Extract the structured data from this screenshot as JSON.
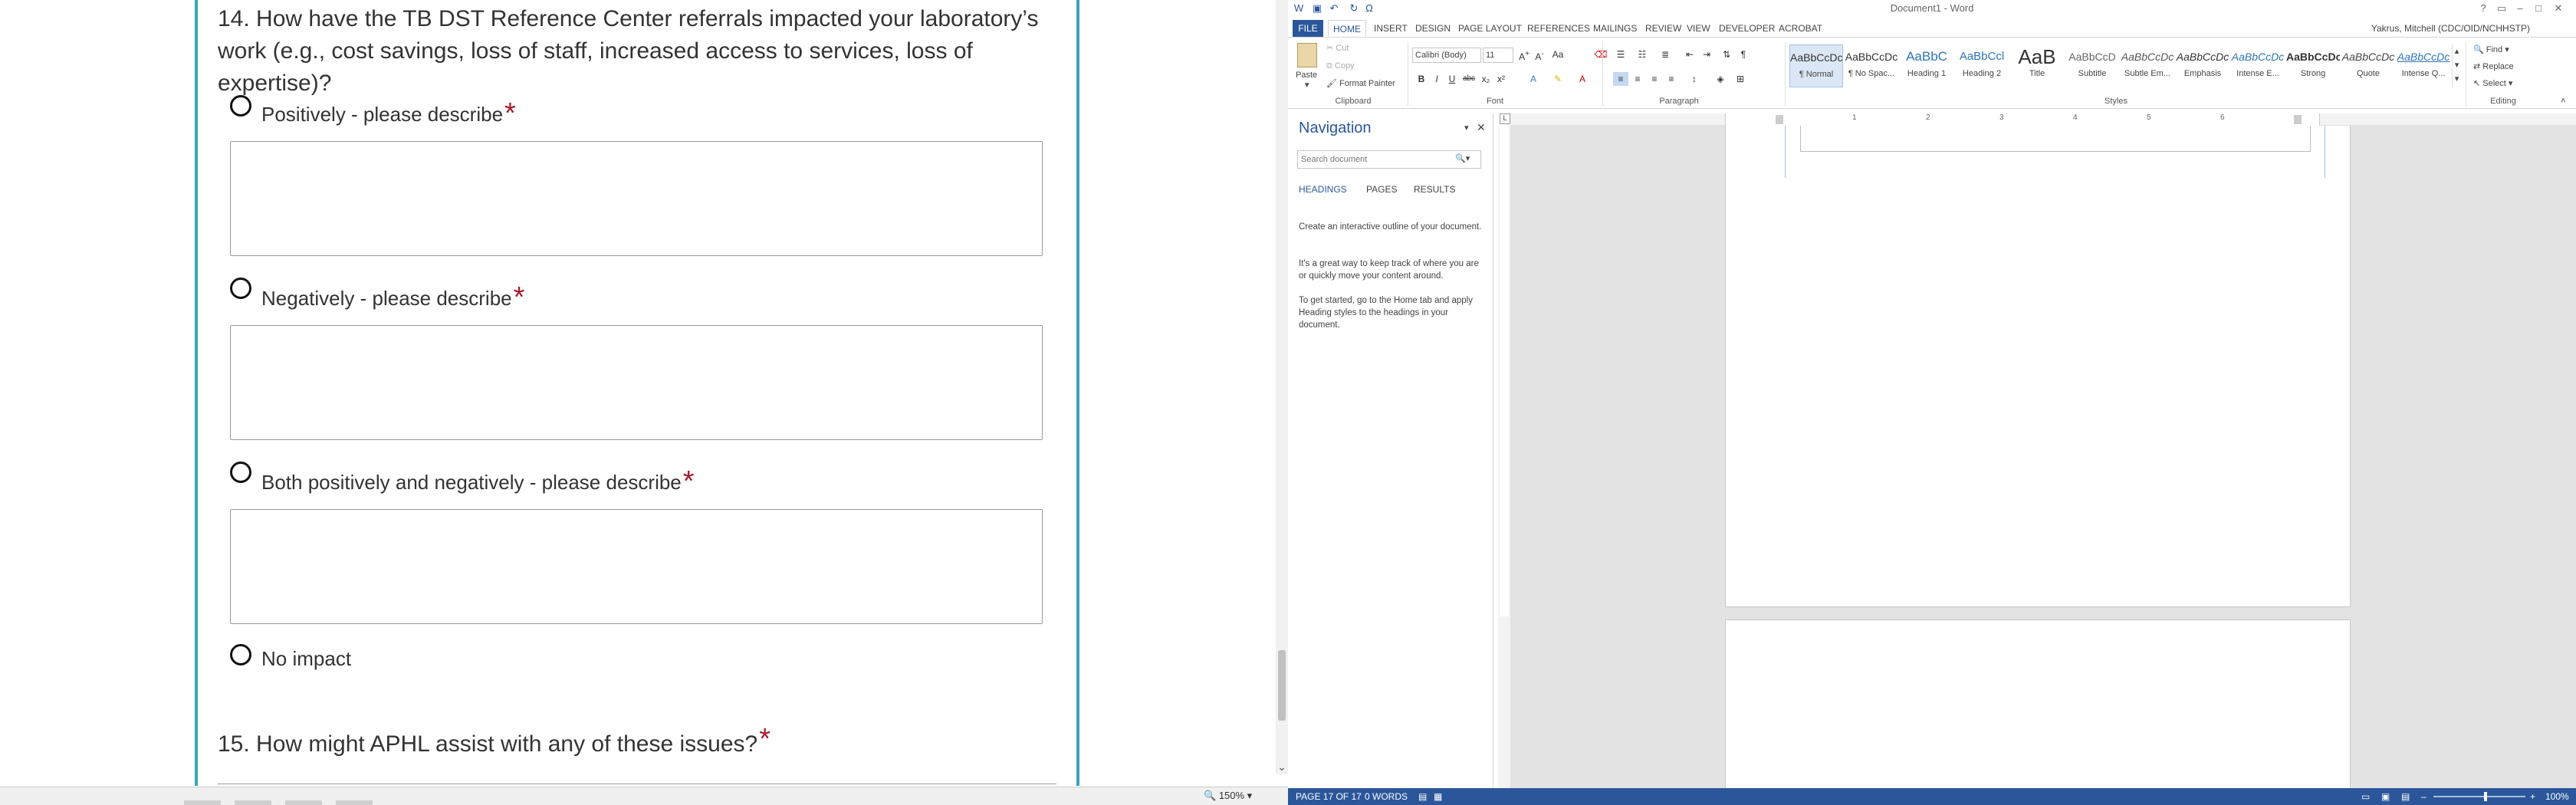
{
  "survey": {
    "q14": {
      "title": "14. How have the TB DST Reference Center referrals impacted your laboratory’s work (e.g., cost savings, loss of staff, increased access to services, loss of expertise)?",
      "options": [
        {
          "label": "Positively - please describe",
          "required": "*"
        },
        {
          "label": "Negatively - please describe",
          "required": "*"
        },
        {
          "label": "Both positively and negatively - please describe",
          "required": "*"
        },
        {
          "label": "No impact",
          "required": ""
        }
      ]
    },
    "q15": {
      "title": "15. How might APHL assist with any of these issues?",
      "required": "*"
    },
    "zoom": "150%"
  },
  "word": {
    "window_title": "Document1 - Word",
    "user": "Yakrus, Mitchell (CDC/OID/NCHHSTP)",
    "tabs": [
      "FILE",
      "HOME",
      "INSERT",
      "DESIGN",
      "PAGE LAYOUT",
      "REFERENCES",
      "MAILINGS",
      "REVIEW",
      "VIEW",
      "DEVELOPER",
      "ACROBAT"
    ],
    "clipboard": {
      "paste": "Paste",
      "cut": "Cut",
      "copy": "Copy",
      "format_painter": "Format Painter",
      "label": "Clipboard"
    },
    "font": {
      "name": "Calibri (Body)",
      "size": "11",
      "label": "Font"
    },
    "paragraph": {
      "label": "Paragraph"
    },
    "styles": {
      "label": "Styles",
      "items": [
        {
          "sample": "AaBbCcDc",
          "name": "¶ Normal"
        },
        {
          "sample": "AaBbCcDc",
          "name": "¶ No Spac..."
        },
        {
          "sample": "AaBbC",
          "name": "Heading 1"
        },
        {
          "sample": "AaBbCcl",
          "name": "Heading 2"
        },
        {
          "sample": "AaB",
          "name": "Title"
        },
        {
          "sample": "AaBbCcD",
          "name": "Subtitle"
        },
        {
          "sample": "AaBbCcDc",
          "name": "Subtle Em..."
        },
        {
          "sample": "AaBbCcDc",
          "name": "Emphasis"
        },
        {
          "sample": "AaBbCcDc",
          "name": "Intense E..."
        },
        {
          "sample": "AaBbCcDc",
          "name": "Strong"
        },
        {
          "sample": "AaBbCcDc",
          "name": "Quote"
        },
        {
          "sample": "AaBbCcDc",
          "name": "Intense Q..."
        }
      ]
    },
    "editing": {
      "find": "Find",
      "replace": "Replace",
      "select": "Select",
      "label": "Editing"
    },
    "nav": {
      "title": "Navigation",
      "search_placeholder": "Search document",
      "tabs": [
        "HEADINGS",
        "PAGES",
        "RESULTS"
      ],
      "para1": "Create an interactive outline of your document.",
      "para2": "It's a great way to keep track of where you are or quickly move your content around.",
      "para3": "To get started, go to the Home tab and apply Heading styles to the headings in your document."
    },
    "ruler_numbers": [
      "1",
      "2",
      "3",
      "4",
      "5",
      "6"
    ],
    "status": {
      "page": "PAGE 17 OF 17",
      "words": "0 WORDS",
      "zoom": "100%"
    }
  }
}
